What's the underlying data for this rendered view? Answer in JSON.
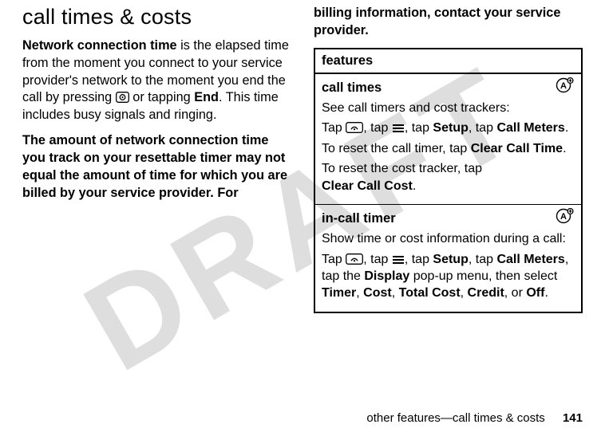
{
  "watermark": "DRAFT",
  "left": {
    "heading": "call times & costs",
    "p1_boldlead": "Network connection time",
    "p1_rest_a": " is the elapsed time from the moment you connect to your service provider's network to the moment you end the call by pressing ",
    "p1_rest_b": " or tapping ",
    "p1_end": "End",
    "p1_tail": ". This time includes busy signals and ringing.",
    "p2": "The amount of network connection time you track on your resettable timer may not equal the amount of time for which you are billed by your service provider. For"
  },
  "right": {
    "top": "billing information, contact your service provider.",
    "table_header": "features",
    "row1": {
      "title": "call times",
      "line1": "See call timers and cost trackers:",
      "line2_a": "Tap ",
      "line2_b": ", tap ",
      "line2_c": ", tap ",
      "line2_setup": "Setup",
      "line2_d": ", tap ",
      "line2_callmeters": "Call Meters",
      "line2_e": ".",
      "line3_a": "To reset the call timer, tap ",
      "line3_bold": "Clear Call Time",
      "line3_b": ".",
      "line4_a": "To reset the cost tracker, tap ",
      "line4_bold": "Clear Call Cost",
      "line4_b": "."
    },
    "row2": {
      "title": "in-call timer",
      "line1": "Show time or cost information during a call:",
      "line2_a": "Tap ",
      "line2_b": ", tap ",
      "line2_c": ", tap ",
      "line2_setup": "Setup",
      "line2_d": ", tap ",
      "line2_callmeters": "Call Meters",
      "line2_e": ", tap the ",
      "line2_display": "Display",
      "line2_f": " pop-up menu, then select ",
      "line2_timer": "Timer",
      "line2_g": ", ",
      "line2_cost": "Cost",
      "line2_h": ", ",
      "line2_total": "Total Cost",
      "line2_i": ", ",
      "line2_credit": "Credit",
      "line2_j": ", or ",
      "line2_off": "Off",
      "line2_k": "."
    }
  },
  "footer": {
    "text": "other features—call times & costs",
    "page": "141"
  }
}
